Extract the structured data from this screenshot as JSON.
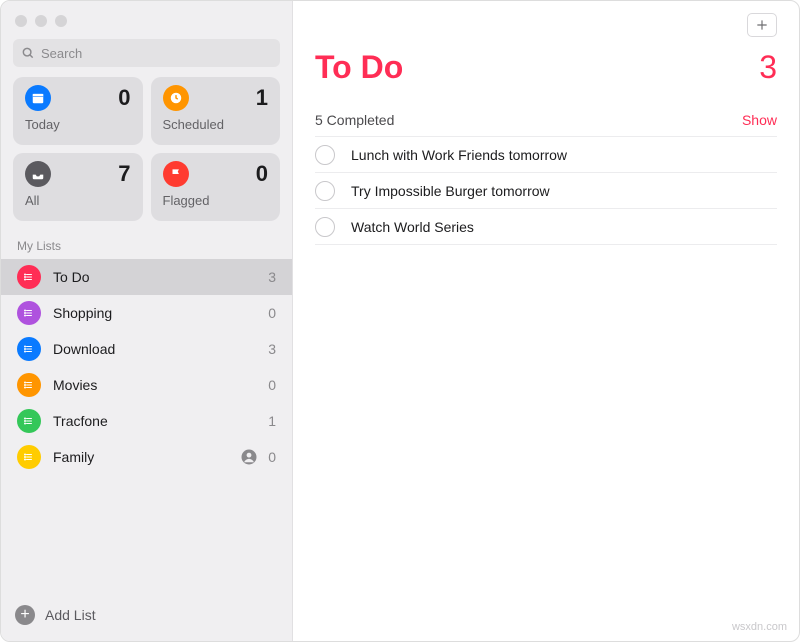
{
  "sidebar": {
    "search_placeholder": "Search",
    "smart": {
      "today": {
        "label": "Today",
        "count": "0"
      },
      "scheduled": {
        "label": "Scheduled",
        "count": "1"
      },
      "all": {
        "label": "All",
        "count": "7"
      },
      "flagged": {
        "label": "Flagged",
        "count": "0"
      }
    },
    "section_label": "My Lists",
    "lists": [
      {
        "name": "To Do",
        "count": "3",
        "color": "c-red",
        "selected": true,
        "shared": false
      },
      {
        "name": "Shopping",
        "count": "0",
        "color": "c-purple",
        "selected": false,
        "shared": false
      },
      {
        "name": "Download",
        "count": "3",
        "color": "c-blue",
        "selected": false,
        "shared": false
      },
      {
        "name": "Movies",
        "count": "0",
        "color": "c-orange",
        "selected": false,
        "shared": false
      },
      {
        "name": "Tracfone",
        "count": "1",
        "color": "c-green",
        "selected": false,
        "shared": false
      },
      {
        "name": "Family",
        "count": "0",
        "color": "c-yellow",
        "selected": false,
        "shared": true
      }
    ],
    "add_list_label": "Add List"
  },
  "main": {
    "title": "To Do",
    "count": "3",
    "completed_label": "5 Completed",
    "show_label": "Show",
    "reminders": [
      {
        "title": "Lunch with Work Friends tomorrow"
      },
      {
        "title": "Try Impossible Burger tomorrow"
      },
      {
        "title": "Watch World Series"
      }
    ]
  },
  "watermark": "wsxdn.com"
}
